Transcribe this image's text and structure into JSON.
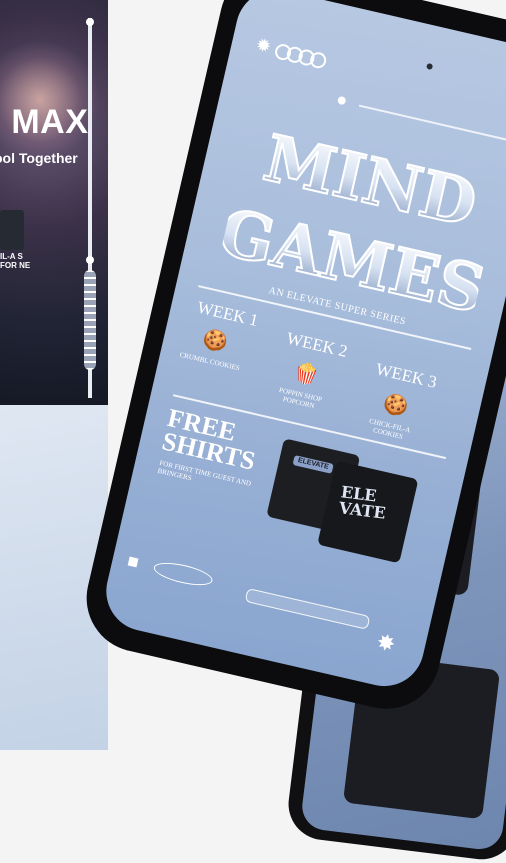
{
  "left_poster": {
    "title": "s MAX",
    "subtitle": "ool Together",
    "promo": "IL-A S FOR NE"
  },
  "app": {
    "logo_text_line1": "MIND",
    "logo_text_line2": "GAMES",
    "tagline": "AN ELEVATE SUPER SERIES",
    "weeks": [
      {
        "label": "WEEK 1",
        "icon": "cookie-icon",
        "treat": "CRUMBL COOKIES"
      },
      {
        "label": "WEEK 2",
        "icon": "popcorn-icon",
        "treat": "POPPIN SHOP POPCORN"
      },
      {
        "label": "WEEK 3",
        "icon": "cookie-icon",
        "treat": "CHICK-FIL-A COOKIES"
      }
    ],
    "promo": {
      "title_line1": "FREE",
      "title_line2": "SHIRTS",
      "subtitle": "FOR FIRST TIME GUEST AND BRINGERS"
    },
    "shirt_front_print": "ELEVATE",
    "shirt_back_print": "ELE VATE"
  },
  "colors": {
    "screen_bg": "#a9bedc",
    "phone_frame": "#0c0c0e",
    "text": "#ffffff"
  }
}
